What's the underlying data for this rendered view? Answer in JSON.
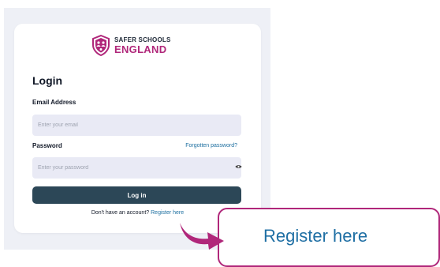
{
  "brand": {
    "line1": "SAFER SCHOOLS",
    "line2": "ENGLAND",
    "color": "#b0277a",
    "icon": "shield-people-icon"
  },
  "login": {
    "title": "Login",
    "email_label": "Email Address",
    "email_placeholder": "Enter your email",
    "password_label": "Password",
    "forgot_link": "Forgotten password?",
    "password_placeholder": "Enter your password",
    "toggle_icon": "eye-icon",
    "submit_label": "Log in",
    "register_prompt": "Don't have an account?",
    "register_link": "Register here",
    "button_color": "#2c4757",
    "link_color": "#1d6fa0"
  },
  "callout": {
    "text": "Register here",
    "border_color": "#b0277a",
    "arrow_icon": "curved-arrow-icon"
  }
}
